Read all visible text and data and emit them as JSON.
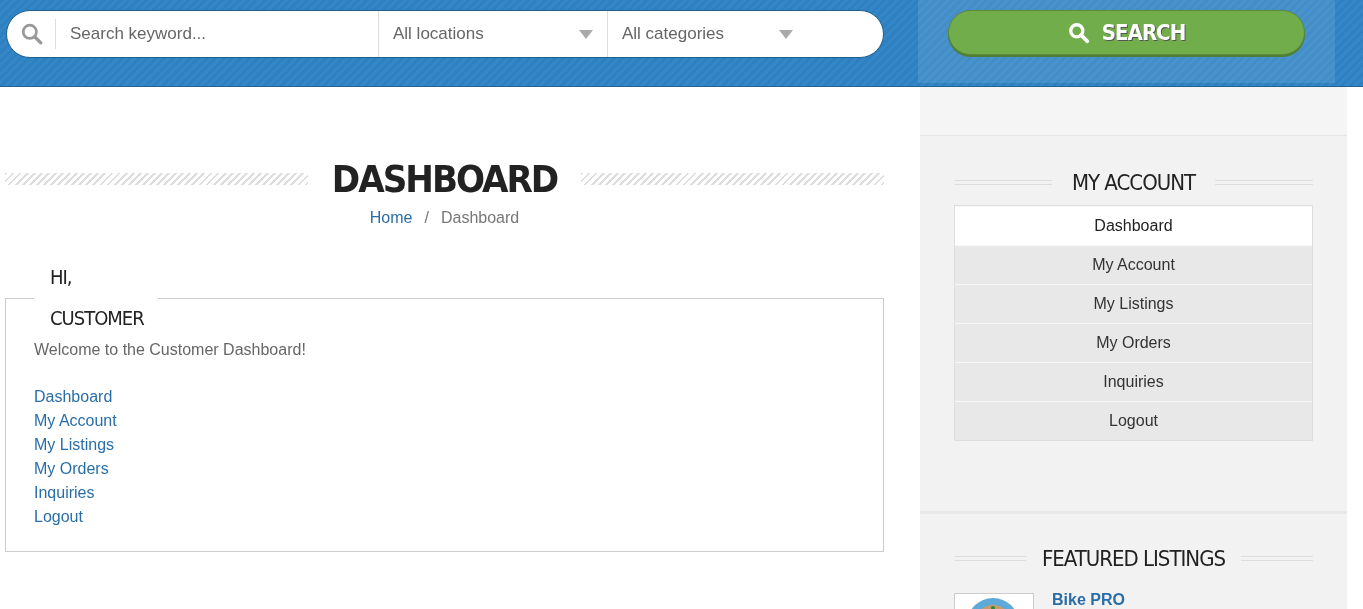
{
  "search_bar": {
    "keyword_placeholder": "Search keyword...",
    "location": "All locations",
    "category": "All categories",
    "button": "SEARCH"
  },
  "page": {
    "title": "DASHBOARD",
    "breadcrumb": [
      {
        "label": "Home",
        "link": true
      },
      {
        "label": "Dashboard",
        "link": false
      }
    ],
    "breadcrumb_separator": "/"
  },
  "greeting_box": {
    "title": "HI, CUSTOMER",
    "welcome": "Welcome to the Customer Dashboard!",
    "links": [
      "Dashboard",
      "My Account",
      "My Listings",
      "My Orders",
      "Inquiries",
      "Logout"
    ]
  },
  "sidebar": {
    "account_title": "MY ACCOUNT",
    "menu": [
      {
        "label": "Dashboard",
        "selected": true
      },
      {
        "label": "My Account",
        "selected": false
      },
      {
        "label": "My Listings",
        "selected": false
      },
      {
        "label": "My Orders",
        "selected": false
      },
      {
        "label": "Inquiries",
        "selected": false
      },
      {
        "label": "Logout",
        "selected": false
      }
    ],
    "featured_title": "FEATURED LISTINGS",
    "featured": [
      {
        "title": "Bike PRO",
        "kind": "picture"
      }
    ]
  }
}
